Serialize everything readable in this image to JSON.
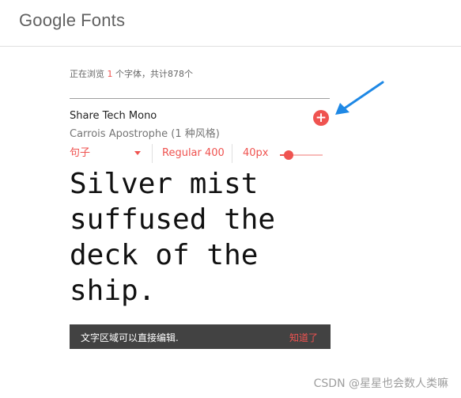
{
  "header": {
    "logo_brand": "Google",
    "logo_product": "Fonts"
  },
  "browse": {
    "prefix": "正在浏览",
    "count": "1",
    "middle": "个字体，共计",
    "total": "878",
    "suffix": "个"
  },
  "card": {
    "font_name": "Share Tech Mono",
    "author": "Carrois Apostrophe (1 种风格)",
    "add_icon": "plus-icon",
    "controls": {
      "mode": "句子",
      "weight": "Regular 400",
      "size": "40px",
      "size_slider_level": 0.2
    },
    "preview_text": "Silver mist suffused the deck of the ship."
  },
  "toast": {
    "message": "文字区域可以直接编辑.",
    "action": "知道了"
  },
  "watermark": "CSDN @星星也会数人类嘛",
  "colors": {
    "accent": "#ef5350",
    "arrow": "#1e88e5",
    "toast_bg": "#424242"
  }
}
